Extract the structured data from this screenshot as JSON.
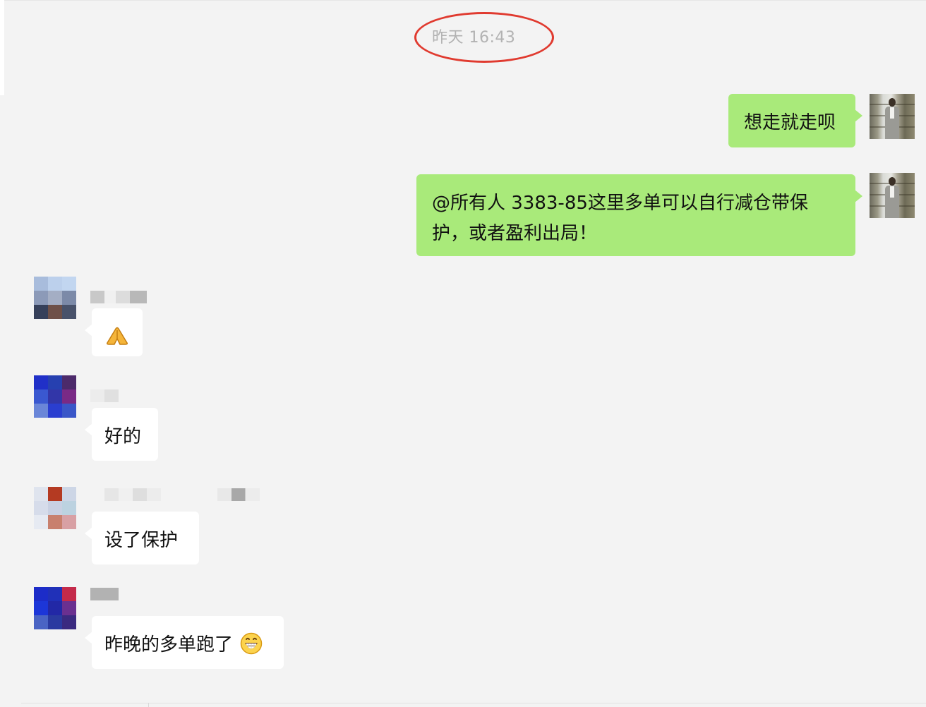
{
  "timestamp": "昨天 16:43",
  "messages": [
    {
      "side": "right",
      "text": "想走就走呗"
    },
    {
      "side": "right",
      "text_line1": "@所有人 3383-85这里多单可以自行减仓带保",
      "text_line2": "护，或者盈利出局！"
    },
    {
      "side": "left",
      "sticker": "folded-hands-emoji"
    },
    {
      "side": "left",
      "text": "好的"
    },
    {
      "side": "left",
      "text": "设了保护"
    },
    {
      "side": "left",
      "text": "昨晚的多单跑了",
      "emoji": "grinning-face-emoji"
    }
  ],
  "colors": {
    "background": "#f3f3f3",
    "self_bubble": "#a9ea7a",
    "other_bubble": "#ffffff",
    "timestamp_text": "#b2b2b2",
    "highlight_ring": "#e03a2f"
  }
}
